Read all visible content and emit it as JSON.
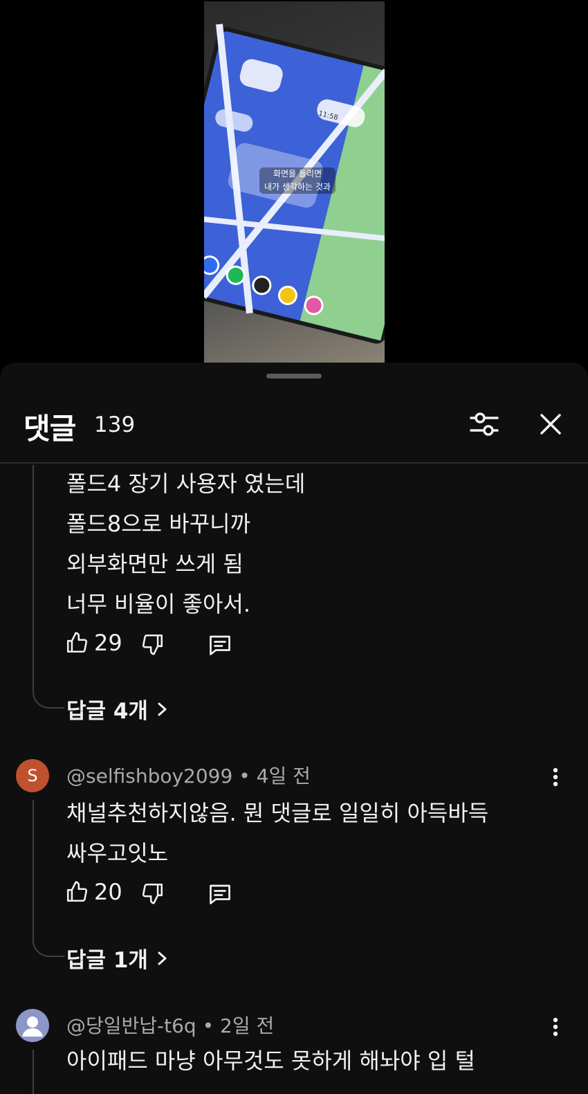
{
  "video": {
    "subtitle_line1": "화면을 돌리면",
    "subtitle_line2": "내가 생각하는 것과",
    "clock_text": "11:58"
  },
  "comments_panel": {
    "title": "댓글",
    "count": "139",
    "icons": {
      "filter": "sort-filter-icon",
      "close": "close-icon"
    }
  },
  "comments": [
    {
      "text_lines": [
        "폴드4 장기 사용자 였는데",
        "폴드8으로 바꾸니까",
        "외부화면만 쓰게 됨",
        "너무 비율이 좋아서."
      ],
      "likes": "29",
      "replies_label": "답글 4개"
    },
    {
      "author": "@selfishboy2099",
      "time": "4일 전",
      "avatar_letter": "S",
      "text_lines": [
        "채널추천하지않음. 뭔 댓글로 일일히 아득바득",
        "싸우고잇노"
      ],
      "likes": "20",
      "replies_label": "답글 1개"
    },
    {
      "author": "@당일반납-t6q",
      "time": "2일 전",
      "text_lines": [
        "아이패드 마냥 아무것도 못하게 해놔야 입 털"
      ]
    }
  ],
  "colors": {
    "sheet_bg": "#0f0f0f",
    "text_primary": "#f1f1f1",
    "text_secondary": "#aaaaaa",
    "avatar_s": "#c0502e",
    "avatar_default": "#8c96c8"
  }
}
